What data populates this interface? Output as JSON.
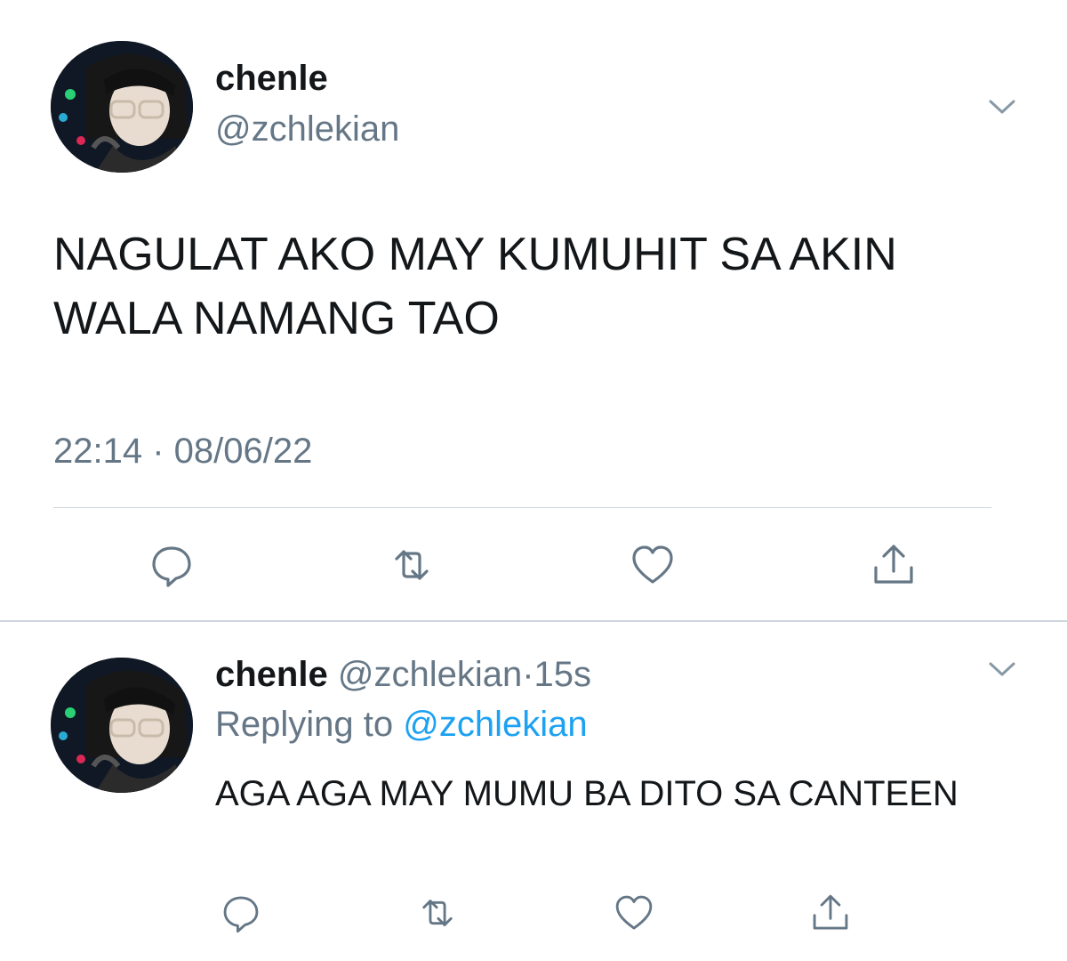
{
  "main_tweet": {
    "display_name": "chenle",
    "handle": "@zchlekian",
    "text": "NAGULAT AKO MAY KUMUHIT SA AKIN WALA NAMANG TAO",
    "timestamp": "22:14 · 08/06/22",
    "menu_icon": "chevron-down-icon",
    "actions": [
      {
        "name": "reply",
        "icon": "speech-bubble-icon"
      },
      {
        "name": "retweet",
        "icon": "retweet-icon"
      },
      {
        "name": "like",
        "icon": "heart-icon"
      },
      {
        "name": "share",
        "icon": "share-icon"
      }
    ]
  },
  "reply_tweet": {
    "display_name": "chenle",
    "handle": "@zchlekian",
    "dot": "·",
    "age": "15s",
    "replying_prefix": "Replying to",
    "replying_handle": "@zchlekian",
    "text": "AGA AGA MAY MUMU BA DITO SA CANTEEN",
    "menu_icon": "chevron-down-icon",
    "actions": [
      {
        "name": "reply",
        "icon": "speech-bubble-icon"
      },
      {
        "name": "retweet",
        "icon": "retweet-icon"
      },
      {
        "name": "like",
        "icon": "heart-icon"
      },
      {
        "name": "share",
        "icon": "share-icon"
      }
    ]
  },
  "colors": {
    "text_primary": "#14171a",
    "text_secondary": "#657786",
    "link": "#1da1f2",
    "divider": "#ced5dc",
    "icon": "#657786"
  }
}
